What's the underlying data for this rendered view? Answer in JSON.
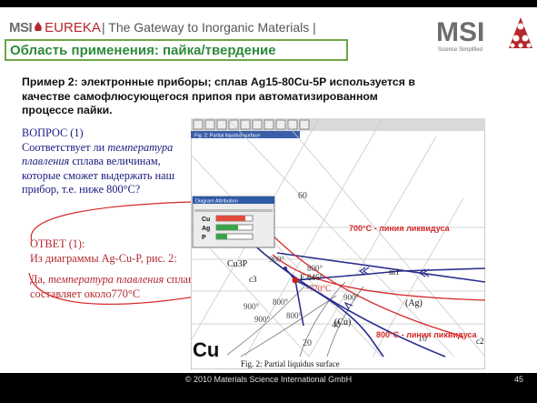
{
  "header": {
    "logo_msi": "MSI",
    "logo_eureka": "EUREKA",
    "tagline": "| The Gateway to Inorganic Materials |",
    "brand_name": "MSI",
    "brand_sub": "Science Simplified"
  },
  "section_title": "Область применения: пайка/твердение",
  "example_text": "Пример 2: электронные приборы; сплав Ag15-80Cu-5P используется в качестве самофлюсующегося припоя при автоматизированном процессе пайки.",
  "question": {
    "heading": "ВОПРОС (1)",
    "line1": "Соответствует ли ",
    "term": "температура плавления",
    "line2": " сплава величинам, которые сможет выдержать наш прибор, т.е. ниже 800°C?"
  },
  "answer": {
    "heading": "ОТВЕТ (1):",
    "line1": "Из диаграммы  Ag-Cu-P, рис. 2:",
    "line2a": "Да, ",
    "term": "температура плавления",
    "line2b": " сплава составляет около770°C"
  },
  "figure": {
    "window_title": "Fig. 2: Partial liquidus surface",
    "panel_title": "Diagram Attribution",
    "panel_items": [
      "Cu",
      "Ag",
      "P"
    ],
    "panel_bars": [
      0.8,
      0.6,
      0.3
    ],
    "caption": "Fig. 2: Partial liquidus surface",
    "phase_cu3p": "Cu3P",
    "phase_ag": "(Ag)",
    "phase_cu": "(Cu)",
    "label_e": "E",
    "label_e_temp": "646°",
    "label_m1": "m1",
    "label_c3": "c3",
    "label_c2": "c2",
    "corner_cu": "Cu",
    "axis_60": "60",
    "axis_40": "40",
    "axis_20": "20",
    "axis_10": "10",
    "iso_900_a": "900°",
    "iso_800_a": "800°",
    "iso_900_b": "900°",
    "iso_800_b": "800°",
    "iso_900_c": "900°",
    "iso_800_c": "800°",
    "iso_900_d": "900°",
    "label_700": "700°C  - линия ликвидуса",
    "label_800": "800°C  - линия ликвидуса",
    "label_770": "~770°C"
  },
  "footer": {
    "copyright": "© 2010 Materials Science International GmbH",
    "page": "45"
  },
  "colors": {
    "accent_green": "#2d8a3a",
    "liquidus_red": "#d62828",
    "line_blue": "#2b2f8f"
  }
}
